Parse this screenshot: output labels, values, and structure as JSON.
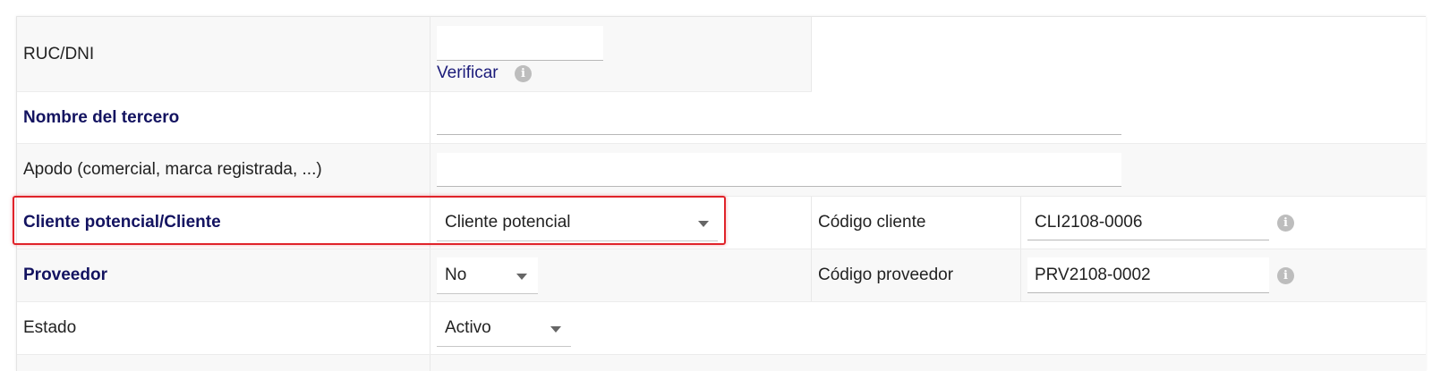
{
  "form": {
    "ruc": {
      "label": "RUC/DNI",
      "value": "",
      "verify_link": "Verificar",
      "info_icon": "info-icon"
    },
    "nombre": {
      "label": "Nombre del tercero",
      "value": ""
    },
    "apodo": {
      "label": "Apodo (comercial, marca registrada, ...)",
      "value": ""
    },
    "cliente": {
      "label": "Cliente potencial/Cliente",
      "selected": "Cliente potencial",
      "code_label": "Código cliente",
      "code_value": "CLI2108-0006",
      "info_icon": "info-icon"
    },
    "proveedor": {
      "label": "Proveedor",
      "selected": "No",
      "code_label": "Código proveedor",
      "code_value": "PRV2108-0002",
      "info_icon": "info-icon"
    },
    "estado": {
      "label": "Estado",
      "selected": "Activo"
    }
  },
  "colors": {
    "required_label": "#131360",
    "link": "#1b1b7a",
    "highlight_border": "#e0232a",
    "row_alt": "#f8f8f8"
  }
}
